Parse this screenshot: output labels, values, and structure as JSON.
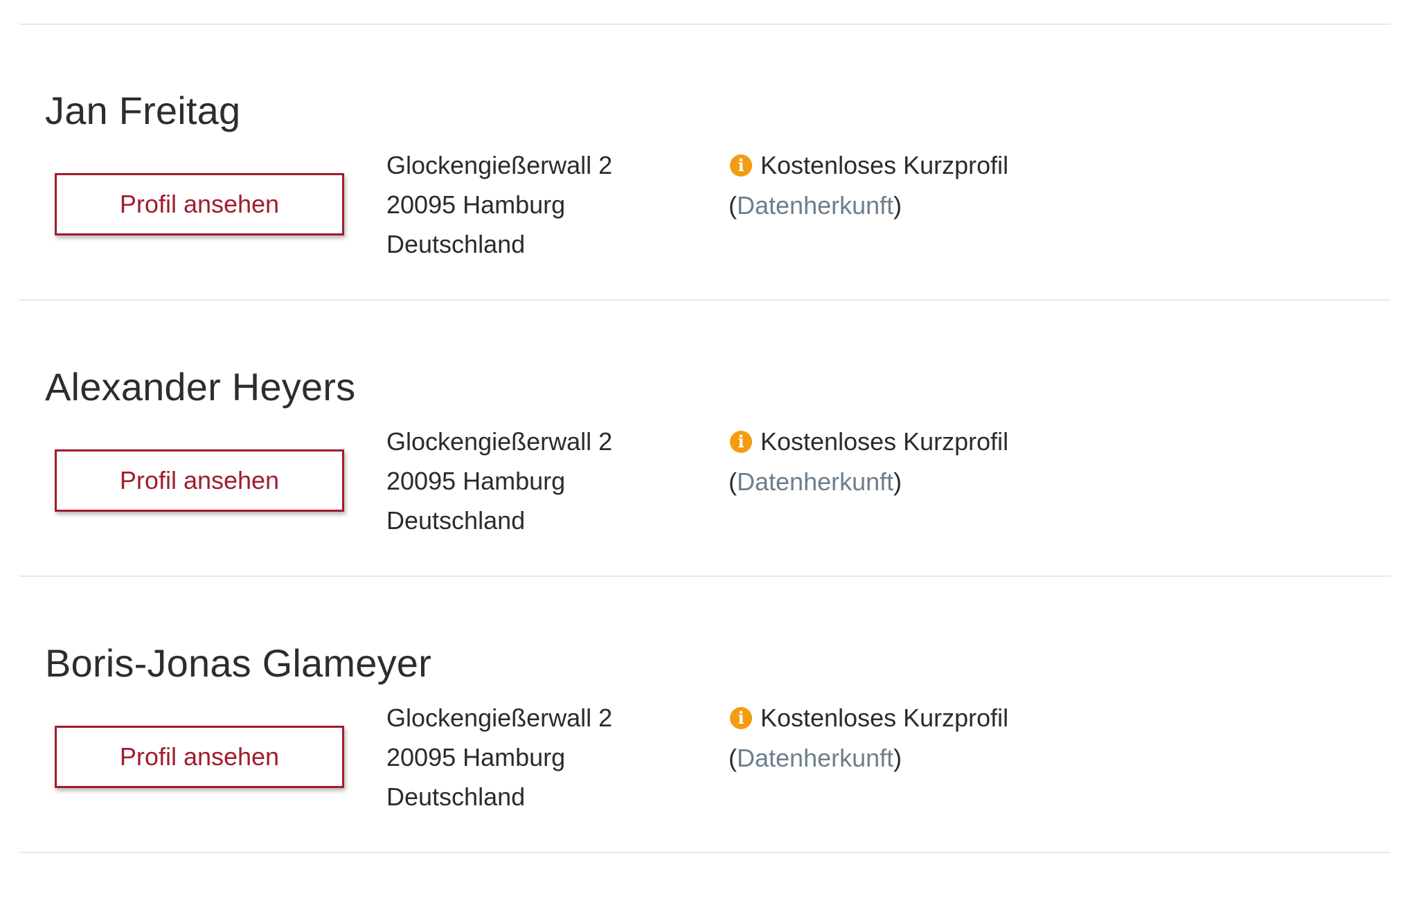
{
  "entries": [
    {
      "name": "Jan Freitag",
      "button_label": "Profil ansehen",
      "address": [
        "Glockengießerwall 2",
        "20095 Hamburg",
        "Deutschland"
      ],
      "info_label": "Kostenloses Kurzprofil",
      "paren_open": "(",
      "source_link": "Datenherkunft",
      "paren_close": ")"
    },
    {
      "name": "Alexander Heyers",
      "button_label": "Profil ansehen",
      "address": [
        "Glockengießerwall 2",
        "20095 Hamburg",
        "Deutschland"
      ],
      "info_label": "Kostenloses Kurzprofil",
      "paren_open": "(",
      "source_link": "Datenherkunft",
      "paren_close": ")"
    },
    {
      "name": "Boris-Jonas Glameyer",
      "button_label": "Profil ansehen",
      "address": [
        "Glockengießerwall 2",
        "20095 Hamburg",
        "Deutschland"
      ],
      "info_label": "Kostenloses Kurzprofil",
      "paren_open": "(",
      "source_link": "Datenherkunft",
      "paren_close": ")"
    }
  ],
  "icons": {
    "info": "info-icon",
    "info_glyph": "i"
  },
  "colors": {
    "button_accent": "#a01c2c",
    "info_icon": "#f39c12",
    "link": "#6d7e8c",
    "divider": "#e8e8e8"
  }
}
